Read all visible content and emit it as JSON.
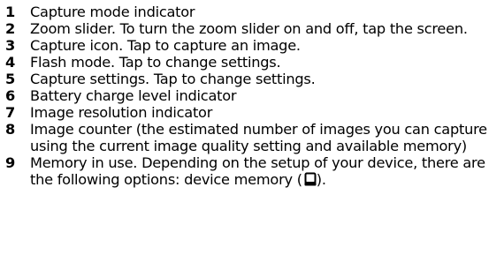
{
  "legend": {
    "items": [
      {
        "number": "1",
        "text": "Capture mode indicator"
      },
      {
        "number": "2",
        "text": "Zoom slider. To turn the zoom slider on and off, tap the screen."
      },
      {
        "number": "3",
        "text": "Capture icon. Tap to capture an image."
      },
      {
        "number": "4",
        "text": "Flash mode. Tap to change settings."
      },
      {
        "number": "5",
        "text": "Capture settings. Tap to change settings."
      },
      {
        "number": "6",
        "text": "Battery charge level indicator"
      },
      {
        "number": "7",
        "text": "Image resolution indicator"
      },
      {
        "number": "8",
        "text": "Image counter (the estimated number of images you can capture using the current image quality setting and available memory)"
      },
      {
        "number": "9",
        "text": "Memory in use. Depending on the setup of your device, there are the following options: device memory (",
        "text_end": ")."
      }
    ],
    "icons": {
      "item9": "device-memory-icon"
    }
  }
}
